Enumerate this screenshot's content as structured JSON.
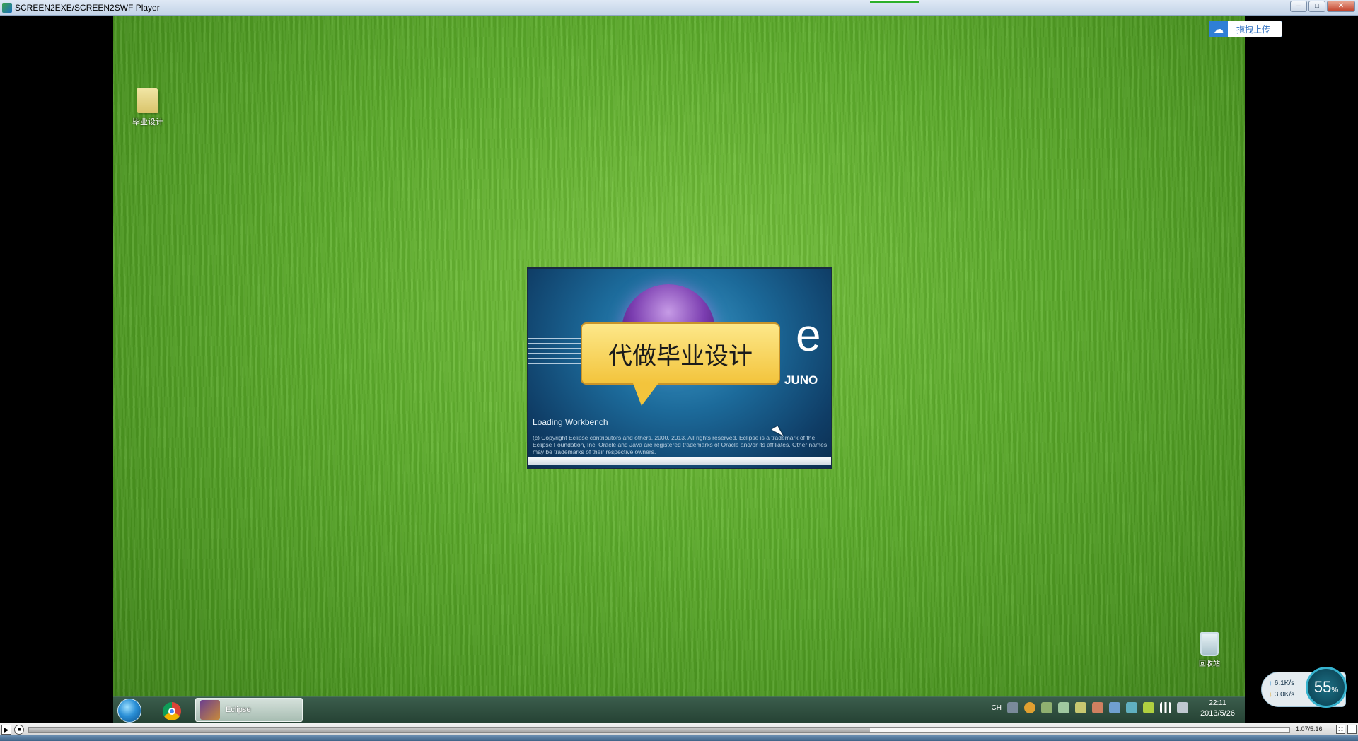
{
  "window": {
    "title": "SCREEN2EXE/SCREEN2SWF Player",
    "minimize_label": "–",
    "maximize_label": "□",
    "close_label": "✕"
  },
  "upload": {
    "label": "拖拽上传",
    "icon": "cloud-icon"
  },
  "desktop": {
    "folder_label": "毕业设计",
    "recycle_bin_label": "回收站"
  },
  "splash": {
    "logo_letter": "e",
    "version_name": "JUNO",
    "overlay_text": "代做毕业设计",
    "status": "Loading Workbench",
    "copyright": "(c) Copyright Eclipse contributors and others, 2000, 2013.  All rights reserved. Eclipse is a trademark of the Eclipse Foundation, Inc. Oracle and Java are registered trademarks of Oracle and/or its affiliates. Other names may be trademarks of their respective owners.",
    "progress": 1.0
  },
  "taskbar": {
    "task_label": "Eclipse",
    "lang": "CH",
    "time": "22:11",
    "date": "2013/5/26"
  },
  "net_widget": {
    "upload_speed": "6.1K/s",
    "download_speed": "3.0K/s",
    "percent": "55",
    "percent_unit": "%"
  },
  "player": {
    "play_label": "▶",
    "stop_label": "■",
    "timecode": "1:07/5:16",
    "progress": 0.667
  }
}
